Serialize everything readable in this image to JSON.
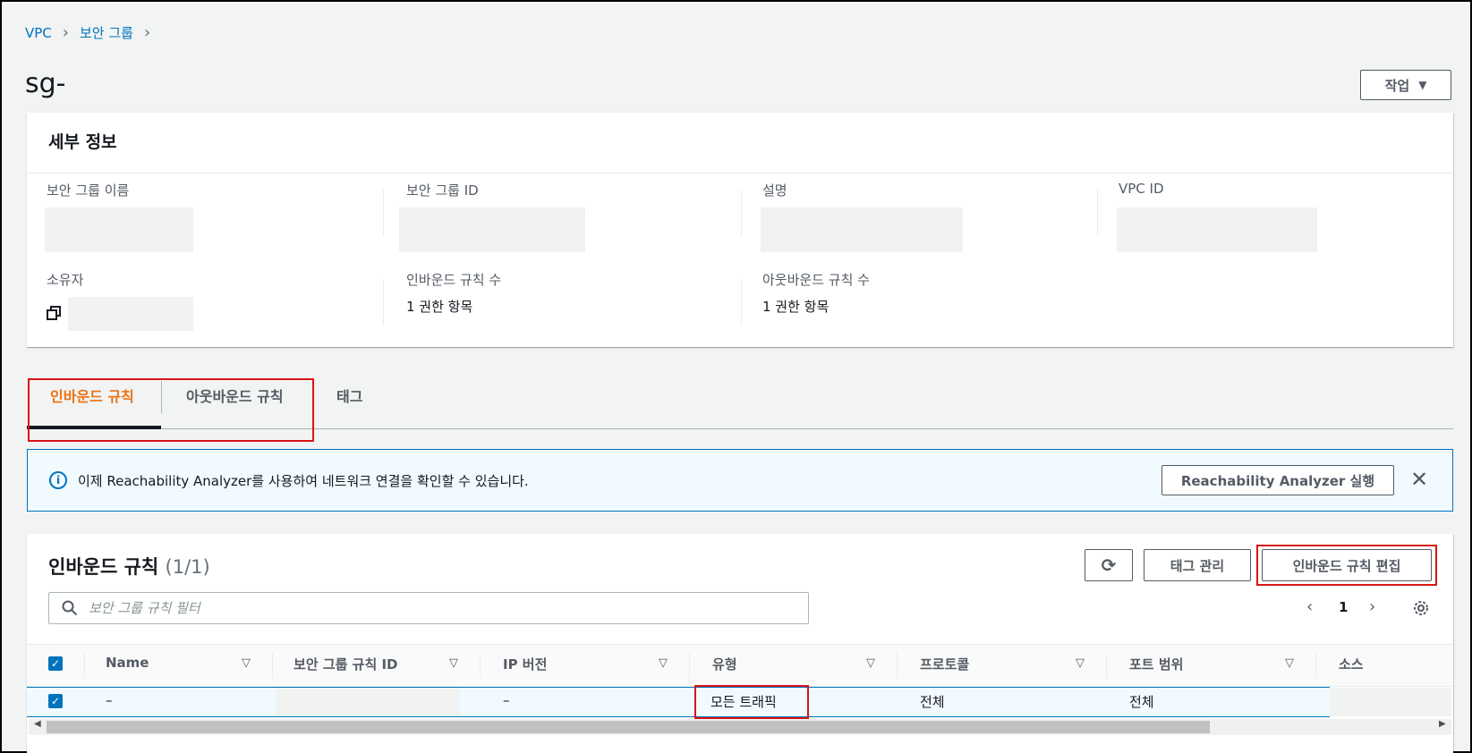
{
  "breadcrumb": {
    "vpc": "VPC",
    "security_groups": "보안 그룹"
  },
  "page": {
    "title": "sg-",
    "actions_label": "작업"
  },
  "details": {
    "title": "세부 정보",
    "fields": {
      "sg_name": "보안 그룹 이름",
      "sg_id": "보안 그룹 ID",
      "description": "설명",
      "vpc_id": "VPC ID",
      "owner": "소유자",
      "inbound_count_label": "인바운드 규칙 수",
      "inbound_count_value": "1 권한 항목",
      "outbound_count_label": "아웃바운드 규칙 수",
      "outbound_count_value": "1 권한 항목"
    }
  },
  "tabs": [
    {
      "label": "인바운드 규칙",
      "active": true
    },
    {
      "label": "아웃바운드 규칙",
      "active": false
    },
    {
      "label": "태그",
      "active": false
    }
  ],
  "alert": {
    "text": "이제 Reachability Analyzer를 사용하여 네트워크 연결을 확인할 수 있습니다.",
    "button": "Reachability Analyzer 실행"
  },
  "rules": {
    "title": "인바운드 규칙",
    "count": "(1/1)",
    "tag_manage_label": "태그 관리",
    "edit_label": "인바운드 규칙 편집",
    "search_placeholder": "보안 그룹 규칙 필터",
    "page_number": "1",
    "columns": [
      "Name",
      "보안 그룹 규칙 ID",
      "IP 버전",
      "유형",
      "프로토콜",
      "포트 범위",
      "소스"
    ],
    "rows": [
      {
        "name": "–",
        "rule_id": "",
        "ip_version": "–",
        "type": "모든 트래픽",
        "protocol": "전체",
        "port_range": "전체",
        "source": ""
      }
    ]
  },
  "colors": {
    "link": "#0073bb",
    "active_tab": "#ec7211",
    "highlight": "#d91515"
  },
  "icons": [
    "chevron-right-icon",
    "caret-down-icon",
    "copy-icon",
    "info-icon",
    "close-icon",
    "refresh-icon",
    "search-icon",
    "settings-icon"
  ]
}
